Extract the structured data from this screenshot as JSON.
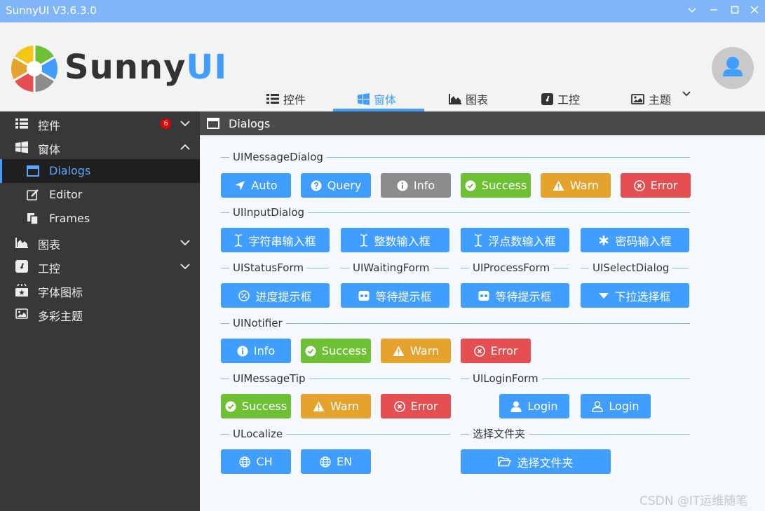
{
  "window": {
    "title": "SunnyUI V3.6.3.0"
  },
  "logo": {
    "text_part1": "Sunny",
    "text_part2": "UI"
  },
  "nav": {
    "items": [
      {
        "label": "控件"
      },
      {
        "label": "窗体"
      },
      {
        "label": "图表"
      },
      {
        "label": "工控"
      },
      {
        "label": "主题"
      }
    ]
  },
  "sidebar": {
    "items": [
      {
        "label": "控件",
        "badge": "6"
      },
      {
        "label": "窗体"
      },
      {
        "label": "Dialogs"
      },
      {
        "label": "Editor"
      },
      {
        "label": "Frames"
      },
      {
        "label": "图表"
      },
      {
        "label": "工控"
      },
      {
        "label": "字体图标"
      },
      {
        "label": "多彩主题"
      }
    ]
  },
  "content": {
    "title": "Dialogs",
    "groups": {
      "message_dialog": "UIMessageDialog",
      "input_dialog": "UIInputDialog",
      "status_form": "UIStatusForm",
      "waiting_form": "UIWaitingForm",
      "process_form": "UIProcessForm",
      "select_dialog": "UISelectDialog",
      "notifier": "UINotifier",
      "message_tip": "UIMessageTip",
      "login_form": "UILoginForm",
      "localize": "ULocalize",
      "folder": "选择文件夹"
    },
    "buttons": {
      "auto": "Auto",
      "query": "Query",
      "info": "Info",
      "success": "Success",
      "warn": "Warn",
      "error": "Error",
      "string_input": "字符串输入框",
      "int_input": "整数输入框",
      "float_input": "浮点数输入框",
      "password_input": "密码输入框",
      "progress": "进度提示框",
      "waiting": "等待提示框",
      "waiting2": "等待提示框",
      "dropdown_select": "下拉选择框",
      "login": "Login",
      "ch": "CH",
      "en": "EN",
      "select_folder": "选择文件夹"
    }
  },
  "watermark": "CSDN @IT运维随笔",
  "colors": {
    "primary": "#409eff",
    "gray": "#8c8c8c",
    "success": "#6ec034",
    "warn": "#e5a22d",
    "error": "#e64f51",
    "sidebar": "#383838"
  }
}
